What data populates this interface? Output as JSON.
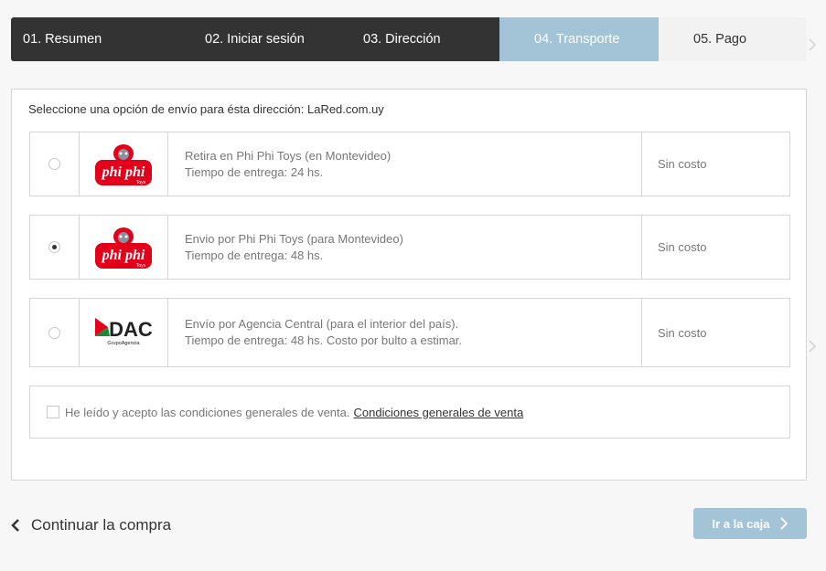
{
  "steps": [
    {
      "label": "01. Resumen",
      "state": "done"
    },
    {
      "label": "02. Iniciar sesión",
      "state": "done"
    },
    {
      "label": "03. Dirección",
      "state": "done"
    },
    {
      "label": "04. Transporte",
      "state": "current"
    },
    {
      "label": "05. Pago",
      "state": "todo"
    }
  ],
  "delivery": {
    "intro": "Seleccione una opción de envío para ésta dirección: LaRed.com.uy",
    "options": [
      {
        "title": "Retira en Phi Phi Toys (en Montevideo)",
        "detail": "Tiempo de entrega: 24 hs.",
        "price": "Sin costo",
        "logo": "phiphi-toys-logo",
        "logo_text": "phi phi",
        "logo_sub": "Toys",
        "selected": false
      },
      {
        "title": "Envio por Phi Phi Toys (para Montevideo)",
        "detail": "Tiempo de entrega: 48 hs.",
        "price": "Sin costo",
        "logo": "phiphi-toys-logo",
        "logo_text": "phi phi",
        "logo_sub": "Toys",
        "selected": true
      },
      {
        "title": "Envío por Agencia Central (para el interior del país).",
        "detail": "Tiempo de entrega: 48 hs. Costo por bulto a estimar.",
        "price": "Sin costo",
        "logo": "dac-logo",
        "logo_text": "DAC",
        "logo_sub": "GrupoAgencia",
        "selected": false
      }
    ]
  },
  "terms": {
    "label": "He leído y acepto las condiciones generales de venta.",
    "link": "Condiciones generales de venta",
    "checked": false
  },
  "nav": {
    "continue_label": "Continuar la compra",
    "checkout_label": "Ir a la caja"
  },
  "colors": {
    "done_step": "#333333",
    "current_step": "#a3c3d6",
    "logo_red": "#e2001a"
  }
}
